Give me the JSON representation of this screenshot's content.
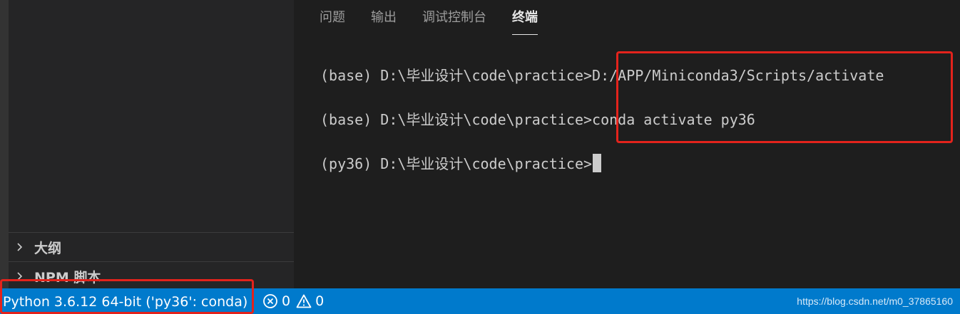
{
  "sidebar": {
    "sections": [
      {
        "label": "大纲"
      },
      {
        "label": "NPM 脚本"
      }
    ]
  },
  "panel": {
    "tabs": [
      {
        "label": "问题",
        "active": false
      },
      {
        "label": "输出",
        "active": false
      },
      {
        "label": "调试控制台",
        "active": false
      },
      {
        "label": "终端",
        "active": true
      }
    ]
  },
  "terminal": {
    "lines": [
      {
        "prompt": "(base) D:\\毕业设计\\code\\practice>",
        "command": "D:/APP/Miniconda3/Scripts/activate"
      },
      {
        "prompt": "(base) D:\\毕业设计\\code\\practice>",
        "command": "conda activate py36"
      },
      {
        "prompt": "(py36) D:\\毕业设计\\code\\practice>",
        "command": ""
      }
    ]
  },
  "statusbar": {
    "interpreter": "Python 3.6.12 64-bit ('py36': conda)",
    "errors": "0",
    "warnings": "0",
    "watermark": "https://blog.csdn.net/m0_37865160"
  },
  "colors": {
    "statusbar": "#007acc",
    "highlight": "#e3231c",
    "editor_bg": "#1e1e1e",
    "sidebar_bg": "#252526"
  },
  "icons": {
    "section_toggle": "chevron-right-icon",
    "errors": "error-circle-icon",
    "warnings": "warning-triangle-icon"
  }
}
